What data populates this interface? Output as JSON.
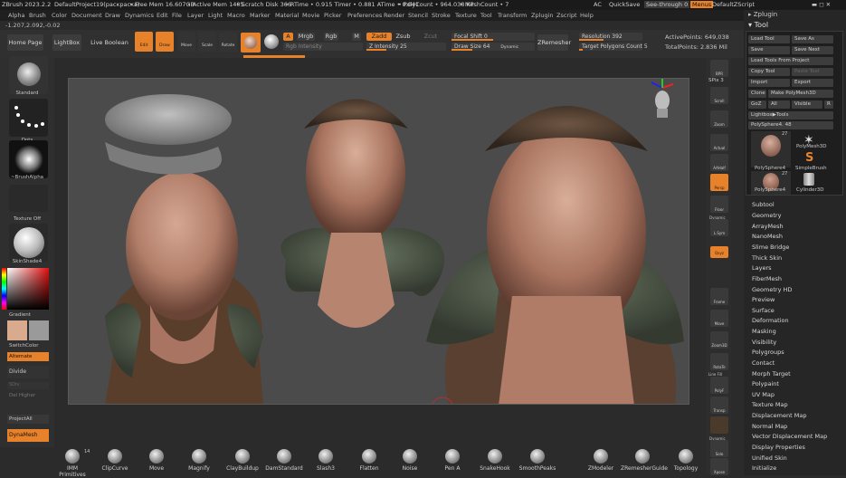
{
  "titlebar": {
    "app": "ZBrush 2023.2.2",
    "project": "DefaultProject19(раскраска)",
    "free_mem": "• Free Mem 16.607GB",
    "active_mem": "• Active Mem 1405",
    "scratch": "• Scratch Disk 366",
    "rtime": "• RTime • 0.915 Timer • 0.881 ATime • 0.041",
    "polycount": "• PolyCount • 964.038 KP",
    "meshcount": "• MeshCount • 7",
    "ac": "AC",
    "quicksave": "QuickSave",
    "seethrough": "See-through  0",
    "menus": "Menus",
    "script": "DefaultZScript"
  },
  "menu": [
    "Alpha",
    "Brush",
    "Color",
    "Document",
    "Draw",
    "Dynamics",
    "Edit",
    "File",
    "Layer",
    "Light",
    "Macro",
    "Marker",
    "Material",
    "Movie",
    "Picker",
    "Preferences",
    "Render",
    "Stencil",
    "Stroke",
    "Texture",
    "Tool",
    "Transform",
    "Zplugin",
    "Zscript",
    "Help"
  ],
  "coords": "-1.207,2.092,-0.02",
  "toolbar": {
    "home": "Home Page",
    "lightbox": "LightBox",
    "live_boolean": "Live Boolean",
    "edit": "Edit",
    "draw": "Draw",
    "move": "Move",
    "scale": "Scale",
    "rotate": "Rotate",
    "a": "A",
    "mrgb": "Mrgb",
    "rgb": "Rgb",
    "m": "M",
    "zadd": "Zadd",
    "zsub": "Zsub",
    "zcut": "Zcut",
    "rgb_intensity": "Rgb Intensity",
    "z_intensity": "Z Intensity",
    "z_intensity_value": "25",
    "focal_shift": "Focal Shift",
    "focal_shift_value": "0",
    "draw_size": "Draw Size",
    "draw_size_value": "64",
    "dynamic": "Dynamic",
    "zremesher": "ZRemesher",
    "resolution": "Resolution",
    "resolution_value": "392",
    "target_poly": "Target Polygons Count",
    "target_poly_value": "5",
    "active_points": "ActivePoints: 649,038",
    "total_points": "TotalPoints: 2.836 Mil"
  },
  "left": {
    "standard": "Standard",
    "dots": "Dots",
    "brushalpha": "~BrushAlpha",
    "texture_off": "Texture Off",
    "skinshade": "SkinShade4",
    "gradient": "Gradient",
    "switchcolor": "SwitchColor",
    "alternate": "Alternate",
    "divide": "Divide",
    "sdiv": "SDiv",
    "del_higher": "Del Higher",
    "projectall": "ProjectAll",
    "dynamesh": "DynaMesh"
  },
  "right": {
    "bpr": "BPR",
    "spix": "SPix 3",
    "scroll": "Scroll",
    "zoom": "Zoom",
    "actual": "Actual",
    "aahalf": "AAHalf",
    "persp": "Persp",
    "floor": "Floor",
    "dynamic": "Dynamic",
    "lsym": "L.Sym",
    "xyz": "Qxyz",
    "frame": "Frame",
    "move": "Move",
    "zoom3d": "Zoom3D",
    "rotate": "RotaTe",
    "linefill": "Line Fill",
    "polyf": "PolyF",
    "transp": "Transp",
    "dynamic2": "Dynamic",
    "solo": "Solo",
    "xpose": "Xpose"
  },
  "panel": {
    "zplugin": "Zplugin",
    "tool": "Tool",
    "load_tool": "Load Tool",
    "save_as": "Save As",
    "save": "Save",
    "save_next": "Save Next",
    "load_from_project": "Load Tools From Project",
    "copy_tool": "Copy Tool",
    "paste_tool": "Paste Tool",
    "import": "Import",
    "export": "Export",
    "clone": "Clone",
    "make_polymesh": "Make PolyMesh3D",
    "goz": "GoZ",
    "all": "All",
    "visible": "Visible",
    "r": "R",
    "lightbox_tools": "Lightbox▶Tools",
    "polysphere_slider": "PolySphere4.",
    "polysphere_value": "48",
    "thumbs": [
      {
        "label": "PolySphere4",
        "count": "27"
      },
      {
        "label": "PolyMesh3D",
        "count": ""
      },
      {
        "label": "SimpleBrush",
        "count": ""
      },
      {
        "label": "PolySphere4",
        "count": "27"
      },
      {
        "label": "Cylinder3D",
        "count": ""
      }
    ],
    "items": [
      "Subtool",
      "Geometry",
      "ArrayMesh",
      "NanoMesh",
      "Slime Bridge",
      "Thick Skin",
      "Layers",
      "FiberMesh",
      "Geometry HD",
      "Preview",
      "Surface",
      "Deformation",
      "Masking",
      "Visibility",
      "Polygroups",
      "Contact",
      "Morph Target",
      "Polypaint",
      "UV Map",
      "Texture Map",
      "Displacement Map",
      "Normal Map",
      "Vector Displacement Map",
      "Display Properties",
      "Unified Skin",
      "Initialize"
    ]
  },
  "bottom": {
    "count": "14",
    "brushes": [
      "IMM Primitives",
      "ClipCurve",
      "Move",
      "Magnify",
      "ClayBuildup",
      "DamStandard",
      "Slash3",
      "Flatten",
      "Noise",
      "Pen A",
      "SnakeHook",
      "SmoothPeaks",
      "ZModeler",
      "ZRemesherGuide",
      "Topology"
    ]
  },
  "colors": {
    "accent": "#e8822a",
    "primary": "#d8ab8e",
    "secondary": "#9a9a9a"
  }
}
